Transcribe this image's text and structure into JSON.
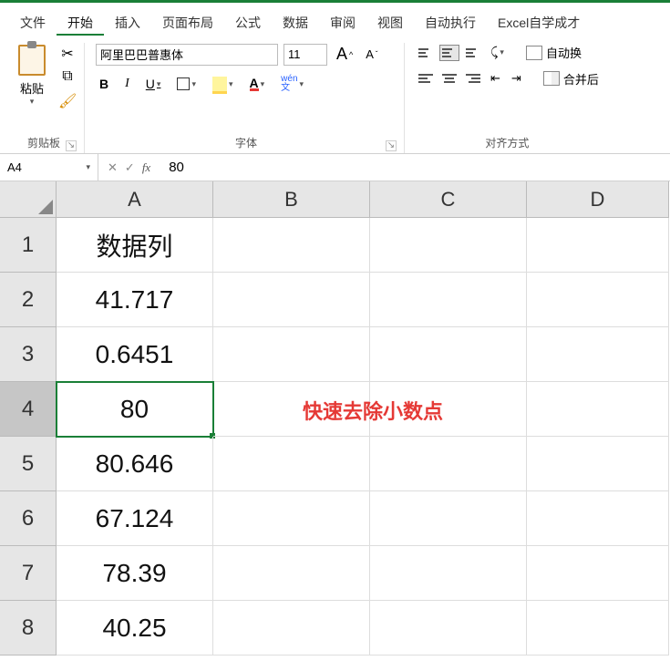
{
  "menu": {
    "items": [
      "文件",
      "开始",
      "插入",
      "页面布局",
      "公式",
      "数据",
      "审阅",
      "视图",
      "自动执行",
      "Excel自学成才"
    ],
    "active_index": 1
  },
  "ribbon": {
    "clipboard": {
      "paste_label": "粘贴",
      "group_label": "剪贴板"
    },
    "font": {
      "family": "阿里巴巴普惠体",
      "size": "11",
      "group_label": "字体",
      "bold": "B",
      "italic": "I",
      "underline": "U",
      "font_color_glyph": "A",
      "pinyin": "wén\n文"
    },
    "alignment": {
      "group_label": "对齐方式",
      "wrap_label": "自动换",
      "merge_label": "合并后"
    }
  },
  "formula_bar": {
    "name_box": "A4",
    "fx": "fx",
    "value": "80"
  },
  "sheet": {
    "columns": [
      "A",
      "B",
      "C",
      "D"
    ],
    "rows": [
      "1",
      "2",
      "3",
      "4",
      "5",
      "6",
      "7",
      "8"
    ],
    "selected_row_index": 3,
    "col_A": [
      "数据列",
      "41.717",
      "0.6451",
      "80",
      "80.646",
      "67.124",
      "78.39",
      "40.25"
    ],
    "annotation": "快速去除小数点"
  }
}
